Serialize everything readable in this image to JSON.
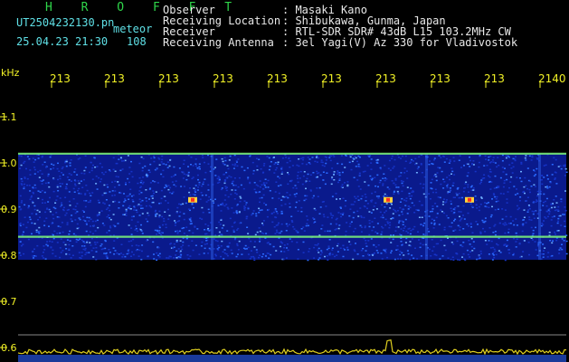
{
  "header": {
    "station_code": "H R O F F T",
    "filename": "UT2504232130.pn",
    "meteor_label": "meteor",
    "date_time": "25.04.23 21:30",
    "meteor_count": "108",
    "info_labels": [
      "Observer",
      "Receiving Location",
      "Receiver",
      "Receiving Antenna"
    ],
    "info_values": [
      ": Masaki Kano",
      ": Shibukawa, Gunma, Japan",
      ": RTL-SDR SDR# 43dB L15 103.2MHz CW",
      ": 3el Yagi(V) Az 330 for Vladivostok"
    ]
  },
  "colors": {
    "background": "#000000",
    "label_green": "#2fd64a",
    "label_cyan": "#5fe0e6",
    "tick_yellow": "#f2f226",
    "noise_low": "#0a1a8c",
    "noise_high": "#2a6aff",
    "echo_line": "#7af07a"
  },
  "chart_data": {
    "type": "heatmap",
    "title": "",
    "ylabel": "kHz",
    "y_ticks": [
      "1.1",
      "1.0",
      "0.9",
      "0.8",
      "0.7",
      "0.6"
    ],
    "x_ticks": [
      "213",
      "213",
      "213",
      "213",
      "213",
      "213",
      "213",
      "213",
      "213",
      "2140"
    ],
    "ylim": [
      0.6,
      1.15
    ],
    "signal_band_khz": [
      0.79,
      1.02
    ],
    "horizontal_lines_khz": [
      1.02,
      0.84
    ],
    "meteor_echo_positions": [
      {
        "x_tick_index": 6.2,
        "khz": 0.92
      },
      {
        "x_tick_index": 2.6,
        "khz": 0.92
      },
      {
        "x_tick_index": 7.7,
        "khz": 0.92
      }
    ]
  }
}
